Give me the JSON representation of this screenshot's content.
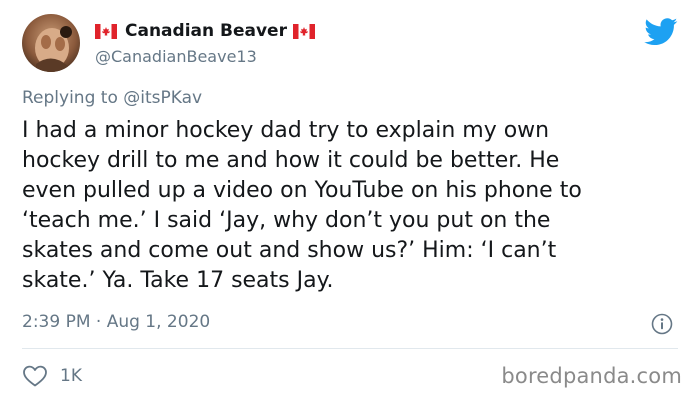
{
  "tweet": {
    "author": {
      "display_name": "Canadian Beaver",
      "handle": "@CanadianBeave13"
    },
    "replying_to": {
      "prefix": "Replying to ",
      "mention": "@itsPKav"
    },
    "text": "I had a minor hockey dad try to explain my own\nhockey drill to me and how it could be better. He\neven pulled up a video on YouTube on his phone to\n‘teach me.’ I said ‘Jay, why don’t you put on the\nskates and come out and show us?’ Him: ‘I can’t\nskate.’ Ya. Take 17 seats Jay.",
    "timestamp": "2:39 PM · Aug 1, 2020",
    "likes": "1K"
  },
  "icons": {
    "platform": "twitter-bird-icon",
    "info": "info-icon",
    "like": "heart-icon",
    "flag": "canada-flag-icon"
  },
  "watermark": "boredpanda.com",
  "colors": {
    "twitter_blue": "#1da1f2",
    "flag_red": "#e0232b",
    "secondary_text": "#657786",
    "primary_text": "#14171a",
    "divider": "#e1e8ed"
  }
}
